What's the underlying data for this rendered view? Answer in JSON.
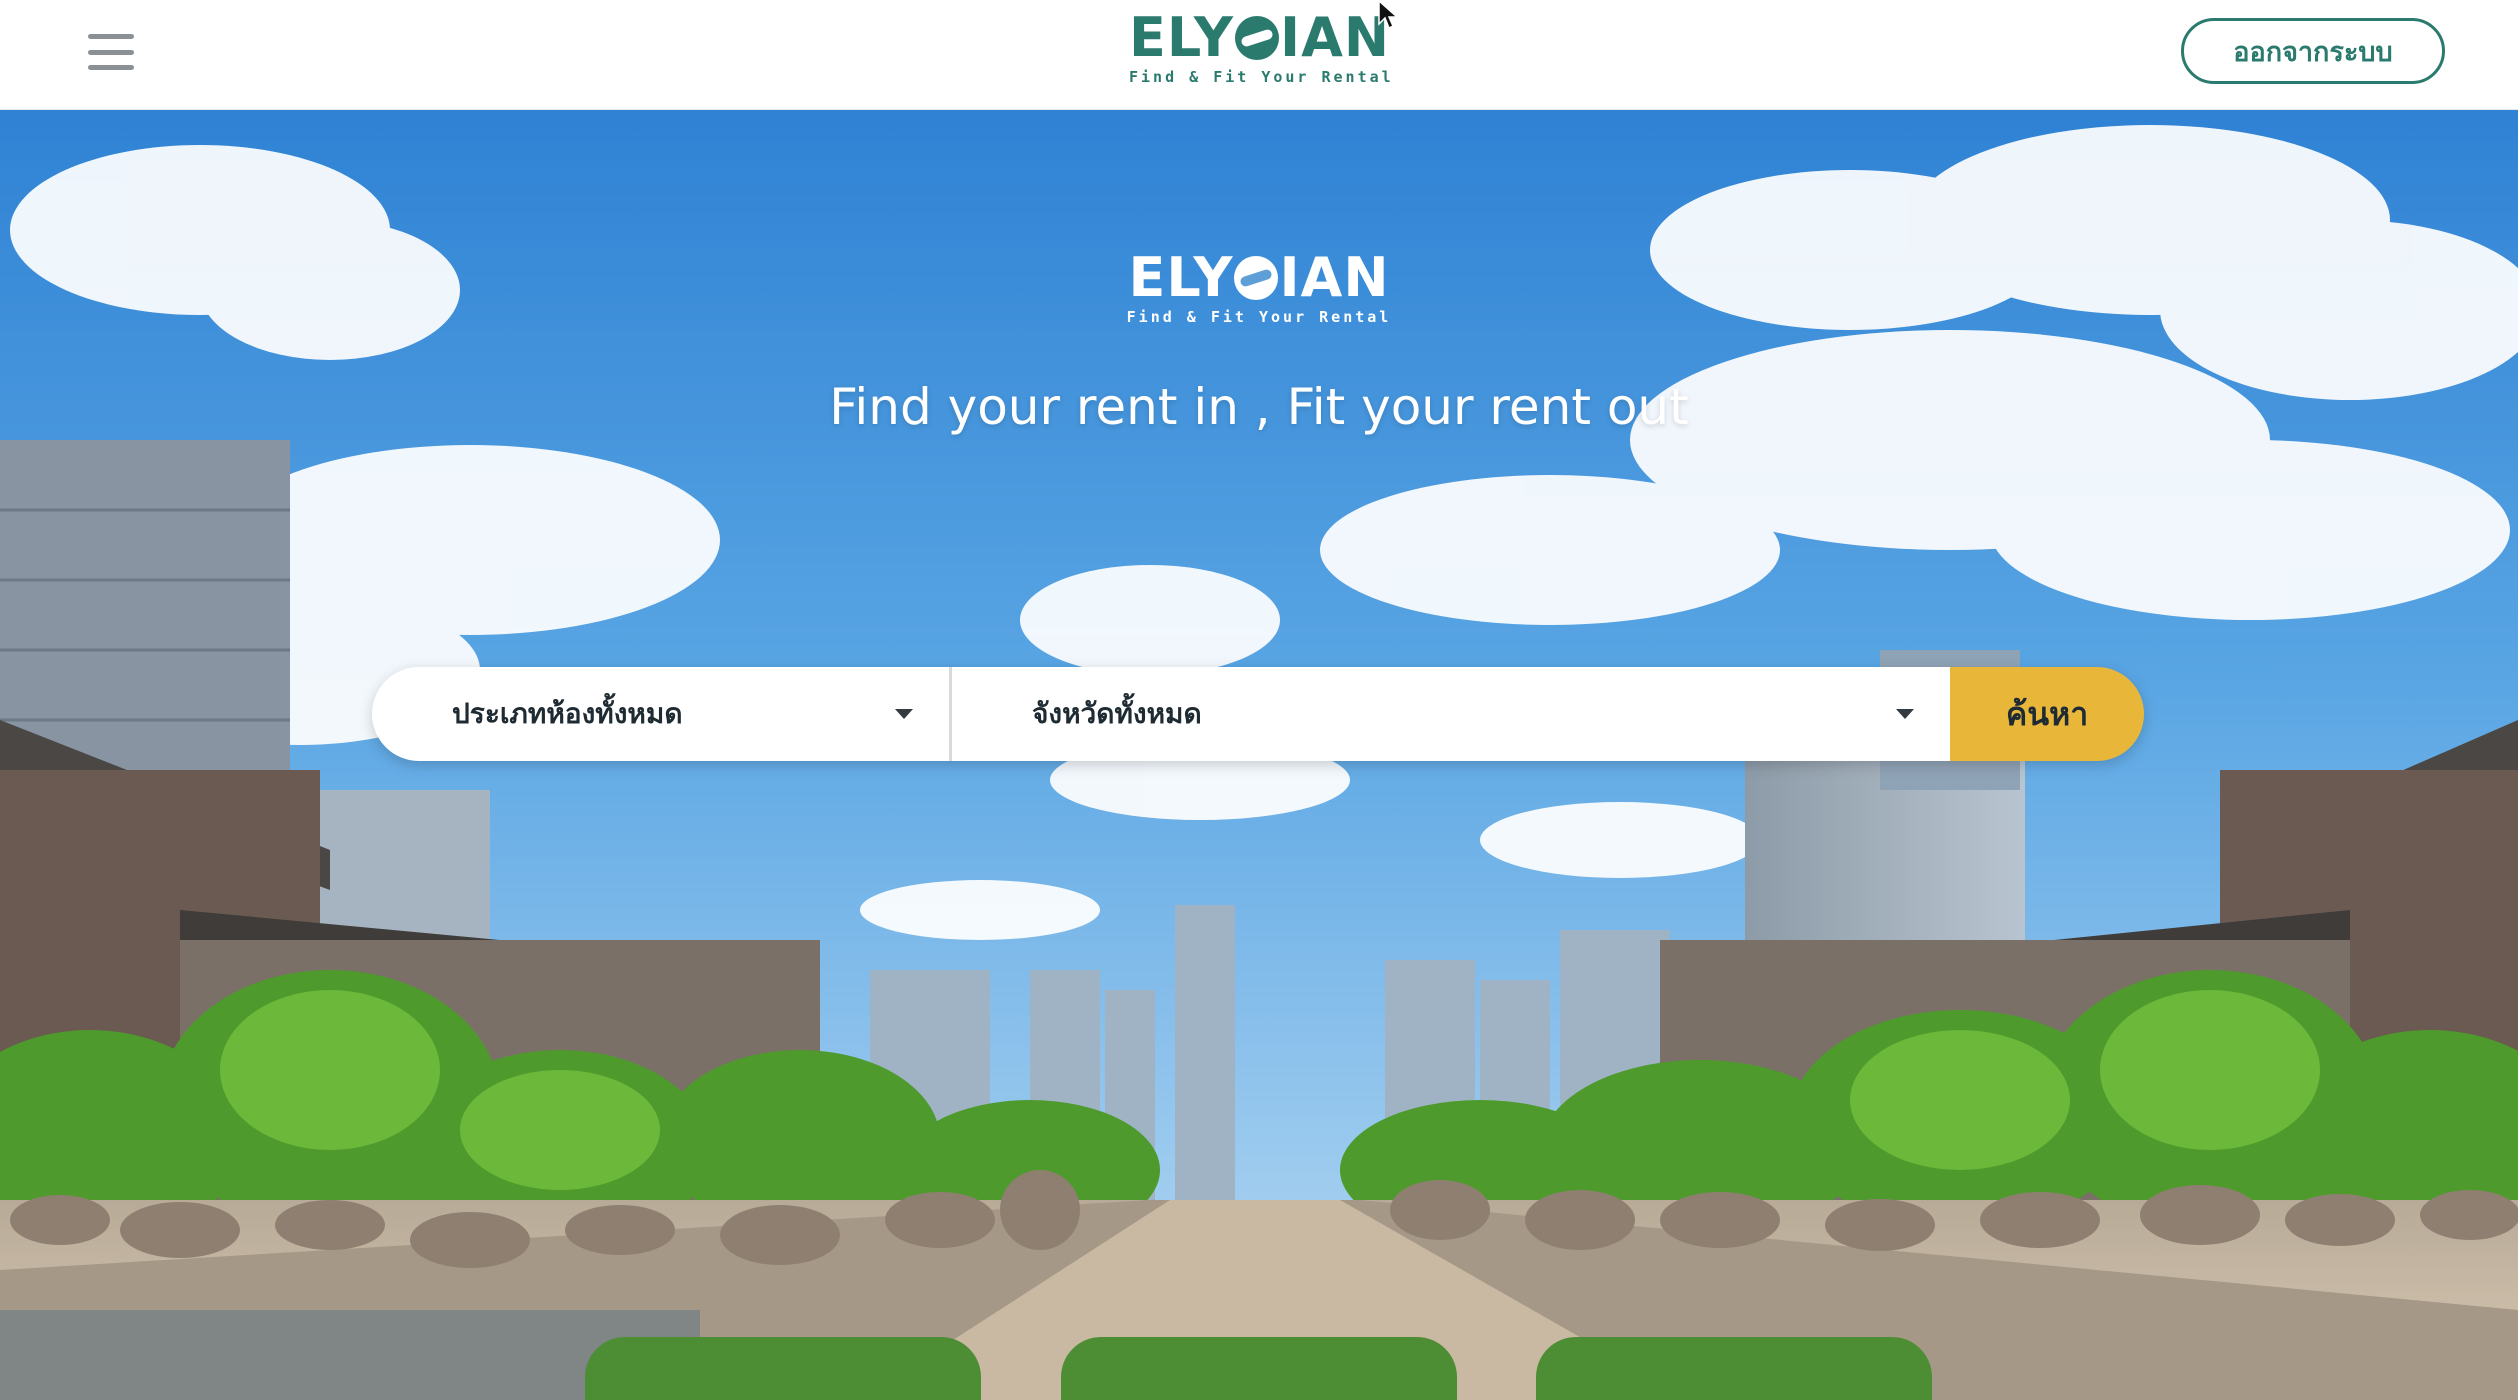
{
  "header": {
    "menu_icon": "hamburger-menu-icon",
    "logo": {
      "word_left": "ELY",
      "word_right": "IAN",
      "tagline": "Find & Fit Your Rental"
    },
    "logout_label": "ออกจากระบบ",
    "brand_color": "#2b7a6e"
  },
  "hero": {
    "logo": {
      "word_left": "ELY",
      "word_right": "IAN",
      "tagline": "Find & Fit Your Rental"
    },
    "tagline": "Find your rent in , Fit your rent out",
    "search": {
      "room_type_value": "ประเภทห้องทั้งหมด",
      "province_value": "จังหวัดทั้งหมด",
      "search_label": "ค้นหา",
      "button_color": "#e8b73a"
    },
    "cards": [
      {
        "icon": "house-icon",
        "color": "#4d8d34"
      },
      {
        "icon": "add-icon",
        "color": "#4d8d34"
      },
      {
        "icon": "list-icon",
        "color": "#4d8d34"
      }
    ]
  }
}
